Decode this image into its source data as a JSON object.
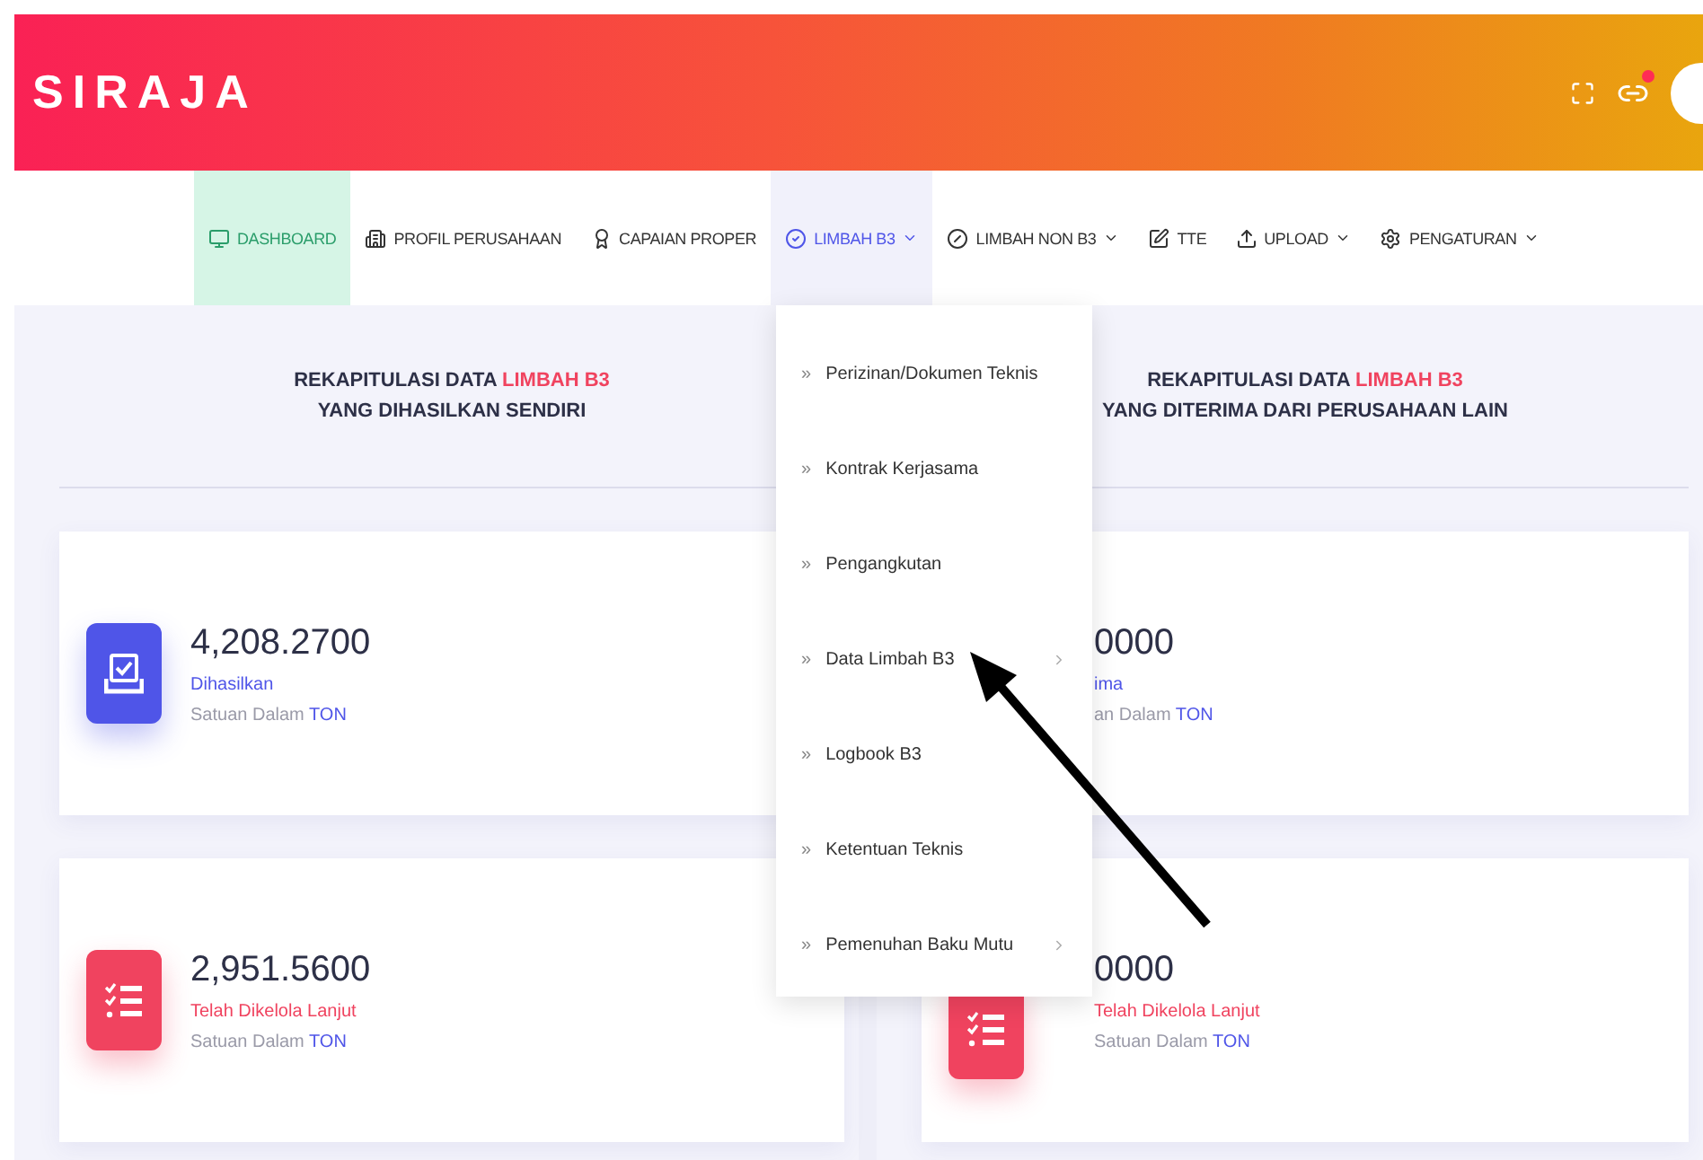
{
  "header": {
    "brand": "SIRAJA",
    "notification_badge": true
  },
  "nav": [
    {
      "label": "DASHBOARD",
      "dropdown": false,
      "selected": true,
      "open": false
    },
    {
      "label": "PROFIL PERUSAHAAN",
      "dropdown": false,
      "selected": false,
      "open": false
    },
    {
      "label": "CAPAIAN PROPER",
      "dropdown": false,
      "selected": false,
      "open": false
    },
    {
      "label": "LIMBAH B3",
      "dropdown": true,
      "selected": false,
      "open": true
    },
    {
      "label": "LIMBAH NON B3",
      "dropdown": true,
      "selected": false,
      "open": false
    },
    {
      "label": "TTE",
      "dropdown": false,
      "selected": false,
      "open": false
    },
    {
      "label": "UPLOAD",
      "dropdown": true,
      "selected": false,
      "open": false
    },
    {
      "label": "PENGATURAN",
      "dropdown": true,
      "selected": false,
      "open": false
    }
  ],
  "dropdown_menu": [
    {
      "bullet": "»",
      "label": "Perizinan/Dokumen Teknis",
      "submenu": false
    },
    {
      "bullet": "»",
      "label": "Kontrak Kerjasama",
      "submenu": false
    },
    {
      "bullet": "»",
      "label": "Pengangkutan",
      "submenu": false
    },
    {
      "bullet": "»",
      "label": "Data Limbah B3",
      "submenu": true
    },
    {
      "bullet": "»",
      "label": "Logbook B3",
      "submenu": false
    },
    {
      "bullet": "»",
      "label": "Ketentuan Teknis",
      "submenu": false
    },
    {
      "bullet": "»",
      "label": "Pemenuhan Baku Mutu",
      "submenu": true
    }
  ],
  "panels": [
    {
      "title_start": "REKAPITULASI DATA",
      "title_highlight": "LIMBAH B3",
      "title_line2": "YANG DIHASILKAN SENDIRI",
      "cards": [
        {
          "covered": false,
          "icon_shown": true,
          "color": "#4f55e8",
          "value": "4,208.2700",
          "label": "Dihasilkan",
          "unit_text": "Satuan Dalam",
          "unit": "TON"
        },
        {
          "covered": false,
          "icon_shown": true,
          "color": "#f0435f",
          "value": "2,951.5600",
          "label": "Telah Dikelola Lanjut",
          "unit_text": "Satuan Dalam",
          "unit": "TON"
        }
      ]
    },
    {
      "title_start": "REKAPITULASI DATA",
      "title_highlight": "LIMBAH B3",
      "title_line2": "YANG DITERIMA DARI PERUSAHAAN LAIN",
      "cards": [
        {
          "covered": true,
          "icon_shown": false,
          "color": "#4f55e8",
          "value": "0000",
          "label": "ima",
          "unit_text": "an Dalam",
          "unit": "TON"
        },
        {
          "covered": true,
          "icon_shown": true,
          "color": "#f0435f",
          "value": "0000",
          "label": "Telah Dikelola Lanjut",
          "unit_text": "Satuan Dalam",
          "unit": "TON"
        }
      ]
    }
  ],
  "annotation": {
    "kind": "arrow"
  }
}
